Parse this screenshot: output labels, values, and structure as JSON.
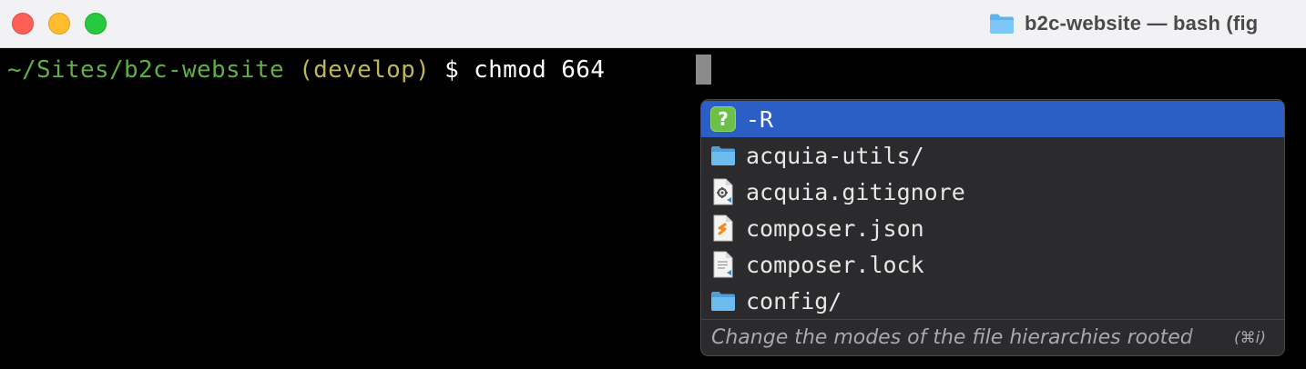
{
  "window": {
    "title": "b2c-website — bash (fig",
    "title_icon": "folder-icon"
  },
  "terminal": {
    "prompt_path": "~/Sites/b2c-website",
    "prompt_branch": "(develop)",
    "prompt_symbol": "$",
    "command": "chmod 664",
    "colors": {
      "path": "#5fae45",
      "branch": "#bfb65a",
      "text": "#ffffff",
      "background": "#000000"
    }
  },
  "autocomplete": {
    "selected_index": 0,
    "suggestions": [
      {
        "label": "-R",
        "icon": "question-option-icon"
      },
      {
        "label": "acquia-utils/",
        "icon": "folder-icon"
      },
      {
        "label": "acquia.gitignore",
        "icon": "gear-file-icon"
      },
      {
        "label": "composer.json",
        "icon": "json-file-icon"
      },
      {
        "label": "composer.lock",
        "icon": "text-file-icon"
      },
      {
        "label": "config/",
        "icon": "folder-icon"
      }
    ],
    "description": "Change the modes of the file hierarchies rooted",
    "shortcut": "(⌘i)",
    "colors": {
      "selected_background": "#2b5fc6",
      "popup_background": "#2b2b2d",
      "folder": "#5fb3ec"
    }
  }
}
